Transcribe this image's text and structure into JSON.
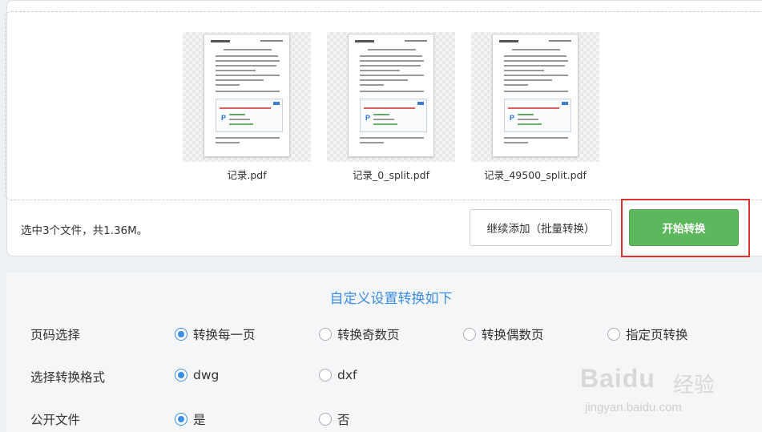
{
  "files": [
    {
      "name": "记录.pdf"
    },
    {
      "name": "记录_0_split.pdf"
    },
    {
      "name": "记录_49500_split.pdf"
    }
  ],
  "summary": "选中3个文件，共1.36M。",
  "buttons": {
    "add_more": "继续添加（批量转换）",
    "start": "开始转换"
  },
  "settings": {
    "title": "自定义设置转换如下",
    "page_selection": {
      "label": "页码选择",
      "options": [
        "转换每一页",
        "转换奇数页",
        "转换偶数页",
        "指定页转换"
      ],
      "selected": "转换每一页"
    },
    "format": {
      "label": "选择转换格式",
      "options": [
        "dwg",
        "dxf"
      ],
      "selected": "dwg"
    },
    "public_file": {
      "label": "公开文件",
      "options": [
        "是",
        "否"
      ],
      "selected": "是"
    }
  },
  "watermark": {
    "brand": "Baidu",
    "brand_cn": "经验",
    "url": "jingyan.baidu.com"
  },
  "colors": {
    "accent_blue": "#3a8ee6",
    "start_green": "#5cb85c",
    "highlight_red": "#e03030"
  }
}
